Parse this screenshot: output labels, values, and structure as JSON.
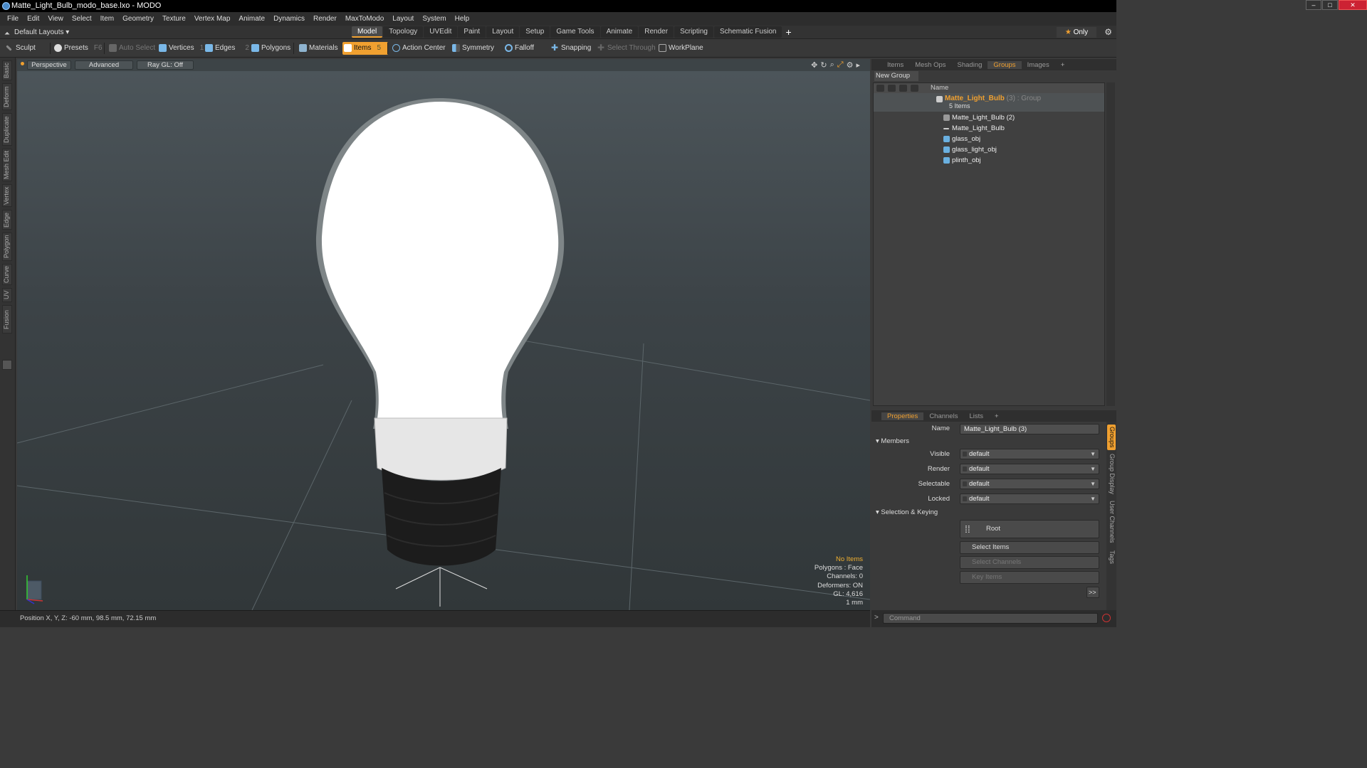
{
  "window": {
    "title": "Matte_Light_Bulb_modo_base.lxo - MODO"
  },
  "menu": [
    "File",
    "Edit",
    "View",
    "Select",
    "Item",
    "Geometry",
    "Texture",
    "Vertex Map",
    "Animate",
    "Dynamics",
    "Render",
    "MaxToModo",
    "Layout",
    "System",
    "Help"
  ],
  "layouts": {
    "selector": "Default Layouts ▾"
  },
  "main_tabs": [
    "Model",
    "Topology",
    "UVEdit",
    "Paint",
    "Layout",
    "Setup",
    "Game Tools",
    "Animate",
    "Render",
    "Scripting",
    "Schematic Fusion"
  ],
  "main_tabs_active": "Model",
  "only_label": "Only",
  "toolbar": {
    "sculpt": "Sculpt",
    "presets": "Presets",
    "presets_key": "F6",
    "auto_select": "Auto Select",
    "vertices": "Vertices",
    "vertices_key": "1",
    "edges": "Edges",
    "edges_key": "2",
    "polygons": "Polygons",
    "materials": "Materials",
    "items": "Items",
    "items_key": "5",
    "action_center": "Action Center",
    "symmetry": "Symmetry",
    "falloff": "Falloff",
    "snapping": "Snapping",
    "select_through": "Select Through",
    "workplane": "WorkPlane"
  },
  "left_tools": [
    "Basic",
    "Deform",
    "Duplicate",
    "Mesh Edit",
    "Vertex",
    "Edge",
    "Polygon",
    "Curve",
    "UV",
    "Fusion"
  ],
  "viewport": {
    "view_mode": "Perspective",
    "advanced": "Advanced",
    "raygl": "Ray GL: Off",
    "info": {
      "no_items": "No Items",
      "polygons": "Polygons : Face",
      "channels": "Channels: 0",
      "deformers": "Deformers: ON",
      "gl": "GL: 4,616",
      "unit": "1 mm"
    }
  },
  "status": {
    "position": "Position X, Y, Z:  -60 mm, 98.5 mm, 72.15 mm"
  },
  "top_panel_tabs": [
    "Items",
    "Mesh Ops",
    "Shading",
    "Groups",
    "Images"
  ],
  "top_panel_active": "Groups",
  "groups": {
    "new_group": "New Group",
    "column_name": "Name",
    "group": {
      "name": "Matte_Light_Bulb",
      "count": "(3)",
      "type": ": Group",
      "sub": "5 Items"
    },
    "items": [
      {
        "label": "Matte_Light_Bulb (2)",
        "icon": "folder-icon"
      },
      {
        "label": "Matte_Light_Bulb",
        "icon": "locator-icon"
      },
      {
        "label": "glass_obj",
        "icon": "mesh-icon"
      },
      {
        "label": "glass_light_obj",
        "icon": "mesh-icon"
      },
      {
        "label": "plinth_obj",
        "icon": "mesh-icon"
      }
    ]
  },
  "bottom_panel_tabs": [
    "Properties",
    "Channels",
    "Lists"
  ],
  "bottom_panel_active": "Properties",
  "properties": {
    "name_label": "Name",
    "name_value": "Matte_Light_Bulb (3)",
    "members_section": "Members",
    "visible_label": "Visible",
    "visible_value": "default",
    "render_label": "Render",
    "render_value": "default",
    "selectable_label": "Selectable",
    "selectable_value": "default",
    "locked_label": "Locked",
    "locked_value": "default",
    "selkey_section": "Selection & Keying",
    "root": "Root",
    "select_items": "Select Items",
    "select_channels": "Select Channels",
    "key_items": "Key Items",
    "more": ">>"
  },
  "side_tabs": [
    "Groups",
    "Group Display",
    "User Channels",
    "Tags"
  ],
  "command": {
    "placeholder": "Command"
  },
  "colors": {
    "accent": "#f0a030",
    "group_name": "#f0a030"
  }
}
